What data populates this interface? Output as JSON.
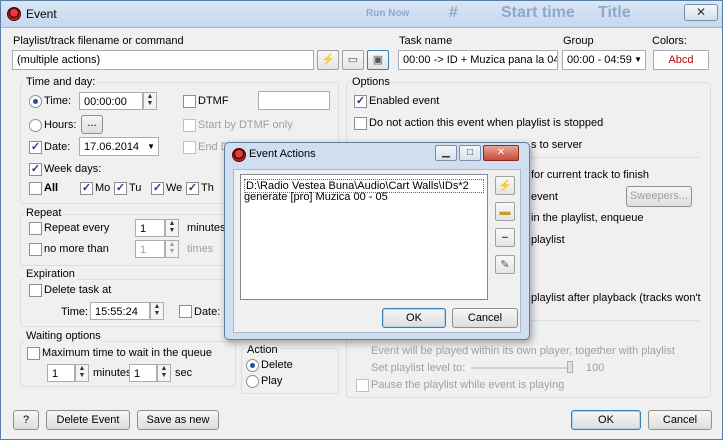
{
  "background": {
    "behind_texts": [
      "Run Now",
      "#",
      "Start time",
      "Title"
    ]
  },
  "window": {
    "title": "Event",
    "close_glyph": "✕"
  },
  "top": {
    "playlist_label": "Playlist/track filename or command",
    "playlist_value": "(multiple actions)",
    "task_name_label": "Task name",
    "task_name_value": "00:00 -> ID + Muzica pana la 04:5",
    "group_label": "Group",
    "group_value": "00:00 - 04:59",
    "colors_label": "Colors:",
    "colors_value": "Abcd",
    "colors_text_color": "#c00000"
  },
  "time_day": {
    "legend": "Time and day:",
    "time_label": "Time:",
    "time_value": "00:00:00",
    "dtmf_label": "DTMF",
    "hours_label": "Hours:",
    "hours_button": "...",
    "start_dtmf_label": "Start by DTMF only",
    "date_label": "Date:",
    "date_value": "17.06.2014",
    "end_dtmf_label": "End DT",
    "week_days_label": "Week days:",
    "days": [
      "All",
      "Mo",
      "Tu",
      "We",
      "Th"
    ]
  },
  "repeat": {
    "legend": "Repeat",
    "repeat_every_label": "Repeat every",
    "repeat_every_value": "1",
    "minutes_label": "minutes",
    "no_more_than_label": "no more than",
    "no_more_than_value": "1",
    "times_label": "times"
  },
  "expiration": {
    "legend": "Expiration",
    "delete_task_label": "Delete task at",
    "time_label": "Time:",
    "time_value": "15:55:24",
    "date_label": "Date:"
  },
  "waiting": {
    "legend": "Waiting options",
    "max_wait_label": "Maximum time to wait in the queue",
    "minutes_value": "1",
    "minutes_label": "minutes",
    "sec_value": "1",
    "sec_label": "sec"
  },
  "action": {
    "legend": "Action",
    "delete_label": "Delete",
    "play_label": "Play"
  },
  "options": {
    "legend": "Options",
    "enabled_label": "Enabled event",
    "do_not_action_label": "Do not action this event when playlist is stopped",
    "server_partial": "s to server",
    "wait_track_partial": "for current track to finish",
    "event_partial": "event",
    "sweepers_button": "Sweepers...",
    "enqueue_partial": "in the playlist, enqueue",
    "playlist_partial": "playlist",
    "after_playback_partial": "playlist after playback (tracks won't",
    "own_player_label": "Event will be played within its own player, together with playlist",
    "set_level_label": "Set playlist level to:",
    "level_value": "100",
    "pause_label": "Pause the playlist while event is playing"
  },
  "bottom": {
    "help_button": "?",
    "delete_event_button": "Delete Event",
    "save_as_new_button": "Save as new",
    "ok_button": "OK",
    "cancel_button": "Cancel"
  },
  "dialog": {
    "title": "Event Actions",
    "actions": [
      "D:\\Radio Vestea Buna\\Audio\\Cart Walls\\IDs*2",
      "generate [pro] Muzica 00 - 05"
    ],
    "ok_button": "OK",
    "cancel_button": "Cancel"
  }
}
